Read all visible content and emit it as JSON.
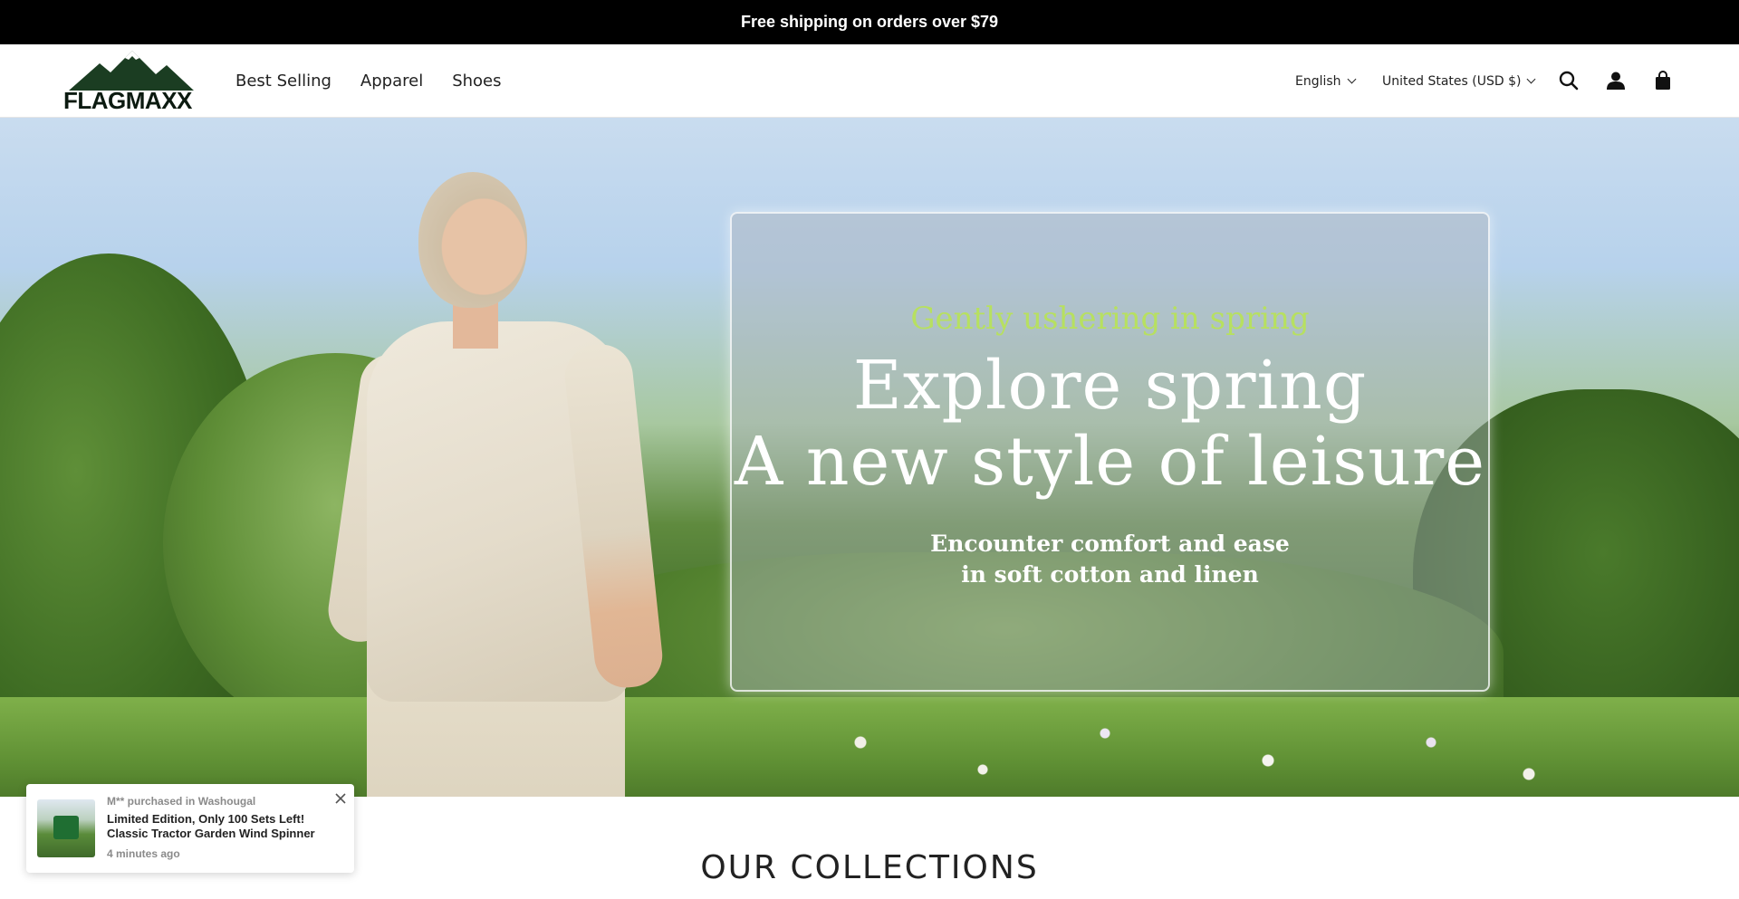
{
  "announcement": {
    "text": "Free shipping on orders over $79"
  },
  "header": {
    "logo_text": "FLAGMAXX",
    "nav": [
      {
        "label": "Best Selling"
      },
      {
        "label": "Apparel"
      },
      {
        "label": "Shoes"
      }
    ],
    "language": "English",
    "country": "United States (USD $)",
    "icons": [
      "search-icon",
      "account-icon",
      "cart-icon"
    ]
  },
  "hero": {
    "subtitle": "Gently ushering in spring",
    "title_line1": "Explore spring",
    "title_line2": "A new style of leisure",
    "desc_line1": "Encounter comfort and ease",
    "desc_line2": "in soft cotton and linen"
  },
  "collections": {
    "heading": "OUR COLLECTIONS"
  },
  "popup": {
    "purchaser": "M** purchased in Washougal",
    "product": "Limited Edition, Only 100 Sets Left! Classic Tractor Garden Wind Spinner",
    "time_ago": "4 minutes ago"
  },
  "colors": {
    "announcement_bg": "#000000",
    "subtitle_green": "#b7e060",
    "logo_dark_green": "#1b3d22"
  }
}
